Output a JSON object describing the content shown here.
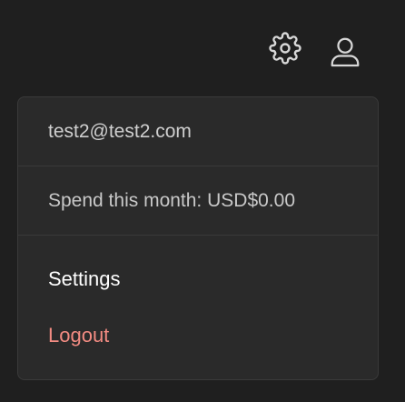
{
  "header": {
    "icons": {
      "settings": "gear-icon",
      "account": "user-icon"
    }
  },
  "account_menu": {
    "email": "test2@test2.com",
    "spend": "Spend this month: USD$0.00",
    "items": [
      {
        "label": "Settings"
      },
      {
        "label": "Logout"
      }
    ]
  },
  "colors": {
    "background": "#1f1f1f",
    "menu_background": "#2a2a2a",
    "divider": "#3a3a3a",
    "logout": "#f28b82",
    "icon": "#d8d8d8"
  }
}
